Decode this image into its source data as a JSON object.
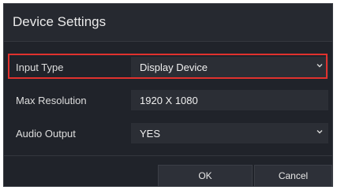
{
  "dialog": {
    "title": "Device Settings"
  },
  "rows": [
    {
      "label": "Input Type",
      "value": "Display Device",
      "control": "dropdown"
    },
    {
      "label": "Max Resolution",
      "value": "1920 X 1080",
      "control": "readonly"
    },
    {
      "label": "Audio Output",
      "value": "YES",
      "control": "dropdown"
    }
  ],
  "buttons": {
    "ok_label": "OK",
    "cancel_label": "Cancel"
  },
  "colors": {
    "background": "#20232a",
    "field": "#2b2e35",
    "highlight": "#e0322e"
  },
  "icons": {
    "dropdown": "chevron-down-icon"
  }
}
